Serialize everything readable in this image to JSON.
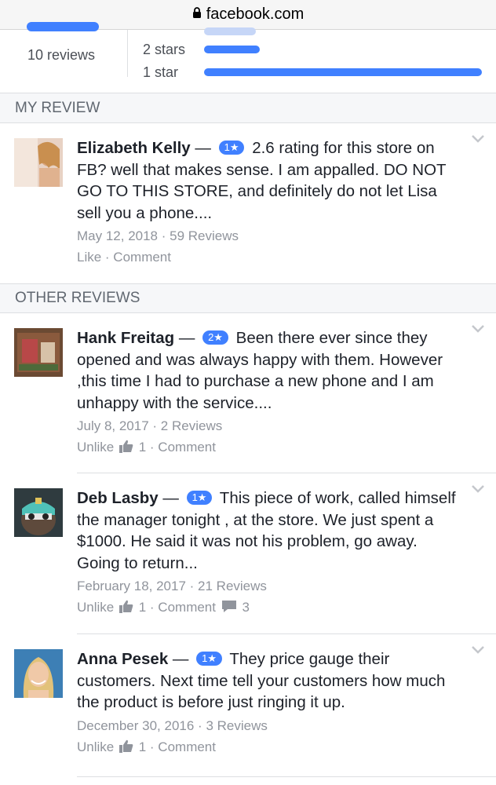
{
  "browser": {
    "url": "facebook.com"
  },
  "summary": {
    "review_count": "10 reviews",
    "rating_rows": [
      {
        "label": "2 stars",
        "fraction": 0.2
      },
      {
        "label": "1 star",
        "fraction": 1.0
      }
    ]
  },
  "my_review": {
    "section_title": "MY REVIEW",
    "review": {
      "author": "Elizabeth Kelly",
      "rating": "1★",
      "text": "2.6 rating for this store on FB? well that makes sense. I am appalled. DO NOT GO TO THIS STORE, and definitely do not let Lisa sell you a phone....",
      "date": "May 12, 2018",
      "reviews": "59 Reviews",
      "like_label": "Like",
      "comment_label": "Comment"
    }
  },
  "other_reviews": {
    "section_title": "OTHER REVIEWS",
    "items": [
      {
        "author": "Hank Freitag",
        "rating": "2★",
        "text": "Been there ever since they opened and was always happy with them. However ,this time I had to purchase a new phone and I am unhappy with the service....",
        "date": "July 8, 2017",
        "reviews": "2 Reviews",
        "unlike_label": "Unlike",
        "likes": "1",
        "comment_label": "Comment"
      },
      {
        "author": "Deb Lasby",
        "rating": "1★",
        "text": "This piece of work, called himself the manager tonight , at the store. We just spent a $1000. He said it was not his problem, go away. Going to return...",
        "date": "February 18, 2017",
        "reviews": "21 Reviews",
        "unlike_label": "Unlike",
        "likes": "1",
        "comment_label": "Comment",
        "comments": "3"
      },
      {
        "author": "Anna Pesek",
        "rating": "1★",
        "text": "They price gauge their customers. Next time tell your customers how much the product is before just ringing it up.",
        "date": "December 30, 2016",
        "reviews": "3 Reviews",
        "unlike_label": "Unlike",
        "likes": "1",
        "comment_label": "Comment"
      }
    ]
  },
  "colors": {
    "accent": "#4080ff",
    "muted": "#90949c",
    "section_bg": "#f6f7f9"
  }
}
